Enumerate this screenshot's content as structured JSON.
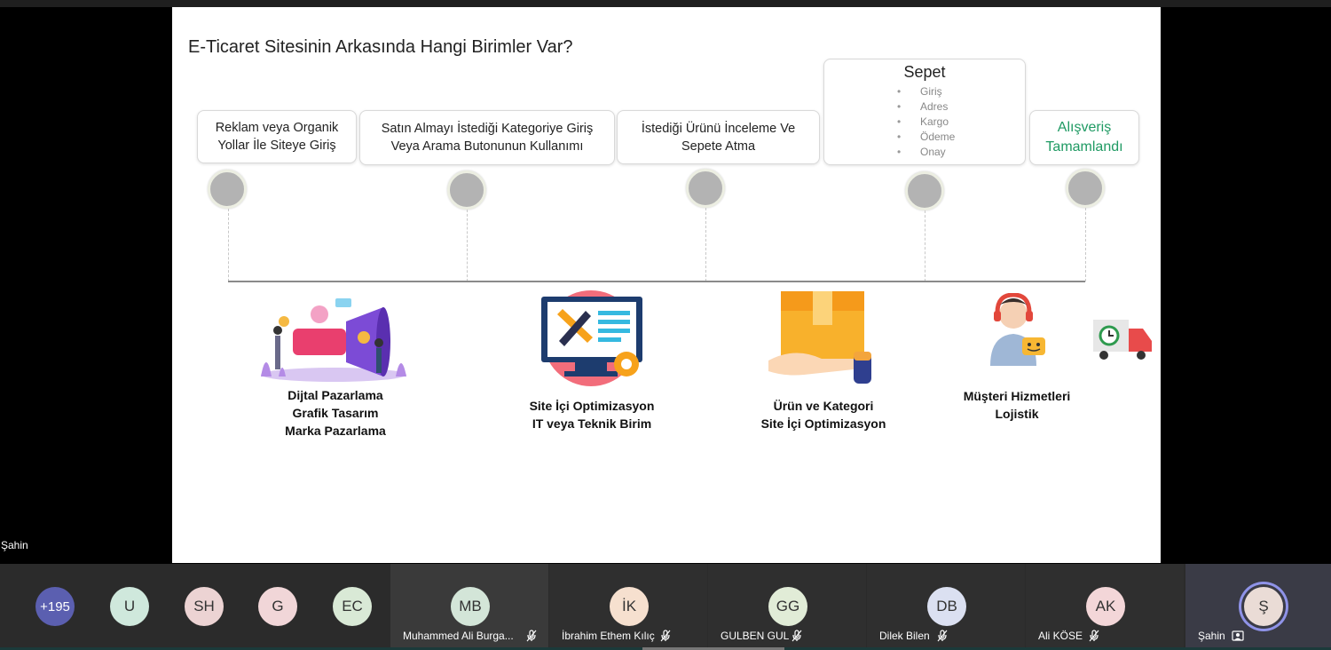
{
  "slide": {
    "title": "E-Ticaret Sitesinin Arkasında Hangi Birimler Var?",
    "steps": [
      {
        "label": "Reklam veya Organik Yollar İle Siteye Giriş"
      },
      {
        "label": "Satın Almayı İstediği Kategoriye Giriş Veya Arama Butonunun Kullanımı"
      },
      {
        "label": "İstediği Ürünü İnceleme Ve Sepete Atma"
      },
      {
        "title": "Sepet",
        "items": [
          "Giriş",
          "Adres",
          "Kargo",
          "Ödeme",
          "Onay"
        ]
      },
      {
        "label": "Alışveriş Tamamlandı"
      }
    ],
    "departments": [
      {
        "line1": "Dijtal Pazarlama",
        "line2": "Grafik Tasarım",
        "line3": "Marka Pazarlama"
      },
      {
        "line1": "Site İçi Optimizasyon",
        "line2": "IT veya Teknik Birim"
      },
      {
        "line1": "Ürün ve Kategori",
        "line2": "Site İçi Optimizasyon"
      },
      {
        "line1": "Müşteri Hizmetleri",
        "line2": "Lojistik"
      }
    ],
    "colors": {
      "done_text": "#1f9a63",
      "node": "#b3b3b3"
    }
  },
  "presenter_label": "Şahin",
  "participants": {
    "more_count": "+195",
    "small": [
      {
        "initials": "U",
        "color": "#cfe8dc"
      },
      {
        "initials": "SH",
        "color": "#ecd3d3"
      },
      {
        "initials": "G",
        "color": "#f1d6d8"
      },
      {
        "initials": "EC",
        "color": "#d9e9d6"
      }
    ],
    "tiles": [
      {
        "initials": "MB",
        "name": "Muhammed Ali Burga...",
        "color": "#d3e5d8"
      },
      {
        "initials": "İK",
        "name": "İbrahim Ethem Kılıç",
        "color": "#f6e0cf"
      },
      {
        "initials": "GG",
        "name": "GULBEN GUL",
        "color": "#e1ecd7"
      },
      {
        "initials": "DB",
        "name": "Dilek Bilen",
        "color": "#dbe0f1"
      },
      {
        "initials": "AK",
        "name": "Ali KÖSE",
        "color": "#f3d6d8"
      },
      {
        "initials": "Ş",
        "name": "Şahin",
        "color": "#eadcd6"
      }
    ]
  }
}
